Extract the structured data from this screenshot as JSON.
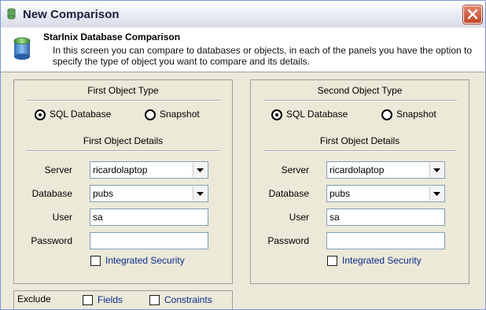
{
  "window": {
    "title": "New Comparison"
  },
  "header": {
    "heading": "StarInix Database Comparison",
    "description": "In this screen you can compare to databases or objects, in each of the panels you have the option to specify the type of object you want to compare and its details."
  },
  "left_panel": {
    "type_title": "First Object Type",
    "radio_sql": "SQL Database",
    "radio_snapshot": "Snapshot",
    "selected": "SQL Database",
    "details_title": "First Object Details",
    "server_label": "Server",
    "server_value": "ricardolaptop",
    "database_label": "Database",
    "database_value": "pubs",
    "user_label": "User",
    "user_value": "sa",
    "password_label": "Password",
    "password_value": "",
    "integrated_security_label": "Integrated Security",
    "integrated_security_checked": false
  },
  "right_panel": {
    "type_title": "Second Object Type",
    "radio_sql": "SQL Database",
    "radio_snapshot": "Snapshot",
    "selected": "SQL Database",
    "details_title": "First Object Details",
    "server_label": "Server",
    "server_value": "ricardolaptop",
    "database_label": "Database",
    "database_value": "pubs",
    "user_label": "User",
    "user_value": "sa",
    "password_label": "Password",
    "password_value": "",
    "integrated_security_label": "Integrated Security",
    "integrated_security_checked": false
  },
  "exclude": {
    "label": "Exclude",
    "fields_label": "Fields",
    "fields_checked": false,
    "constraints_label": "Constraints",
    "constraints_checked": false
  },
  "icons": [
    "app-icon",
    "close-icon",
    "database-icon",
    "chevron-down-icon"
  ]
}
